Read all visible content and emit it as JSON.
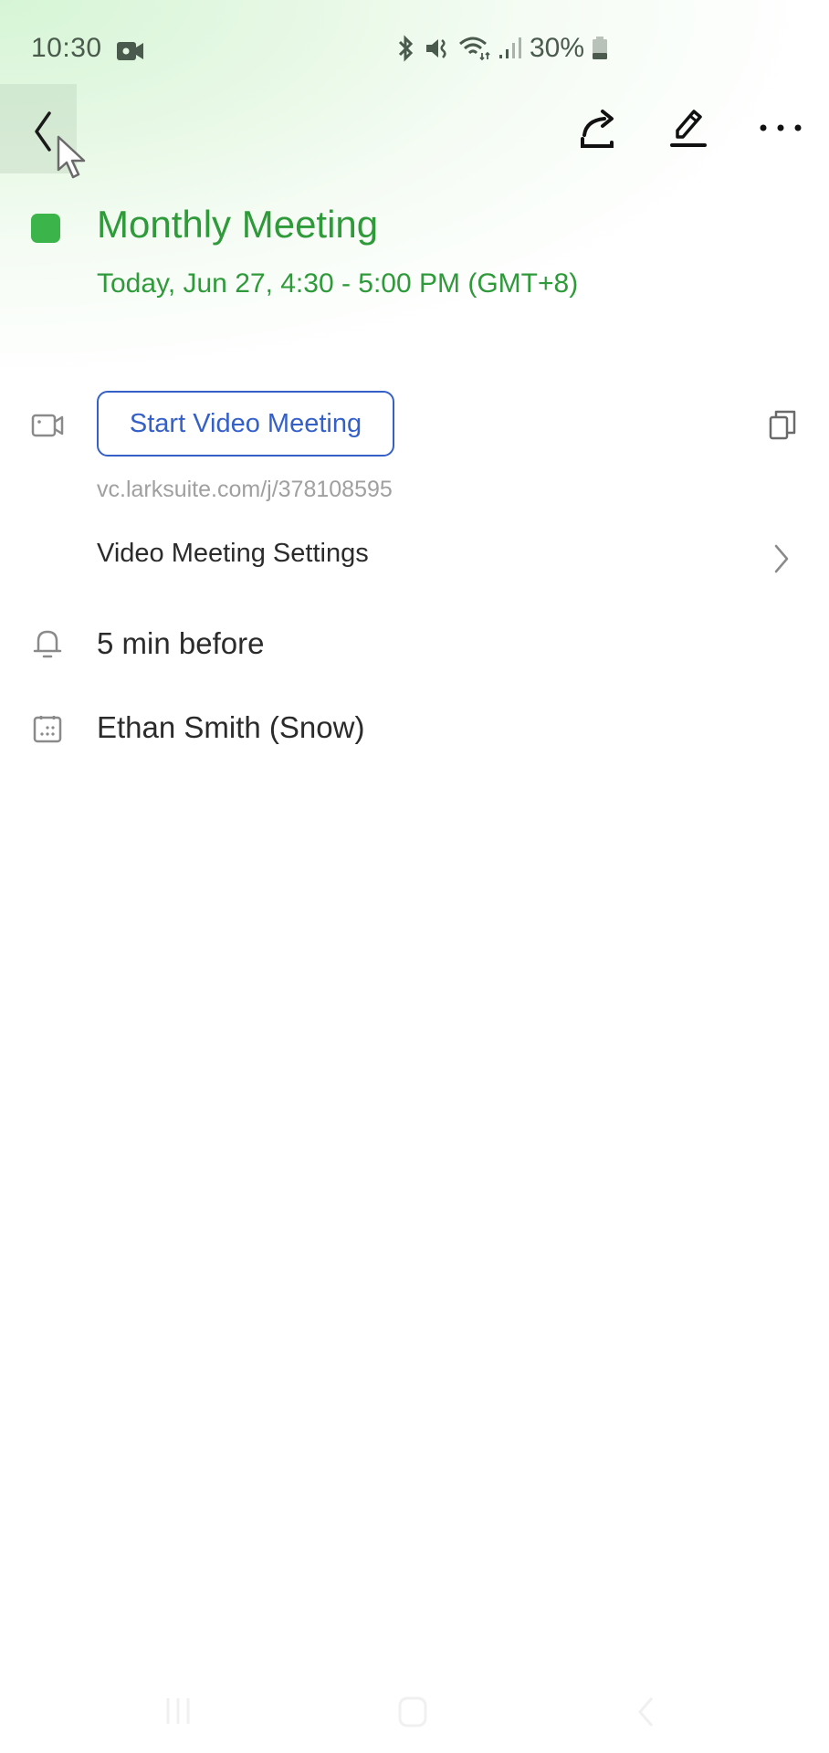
{
  "status_bar": {
    "time": "10:30",
    "recording_icon": "video-record-icon",
    "icons": [
      "bluetooth-icon",
      "mute-icon",
      "wifi-icon",
      "signal-icon"
    ],
    "battery_percent": "30%",
    "battery_level": 0.3
  },
  "top_bar": {
    "back_icon": "chevron-left-icon",
    "actions": [
      "share-icon",
      "edit-icon",
      "more-icon"
    ]
  },
  "event": {
    "color": "#3bb54a",
    "title": "Monthly Meeting",
    "datetime": "Today, Jun 27, 4:30 - 5:00 PM (GMT+8)"
  },
  "video_meeting": {
    "start_button_label": "Start Video Meeting",
    "link": "vc.larksuite.com/j/378108595",
    "settings_label": "Video Meeting Settings"
  },
  "reminder": {
    "text": "5 min before"
  },
  "calendar": {
    "owner": "Ethan Smith (Snow)"
  },
  "colors": {
    "accent_green": "#2e9a3a",
    "button_blue": "#3560c8"
  }
}
